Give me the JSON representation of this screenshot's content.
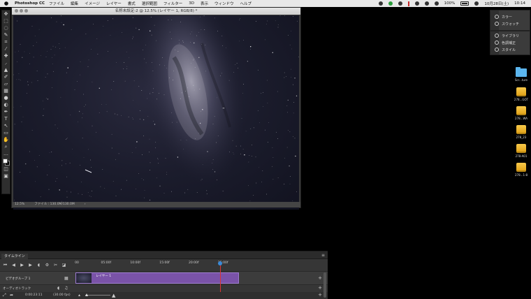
{
  "menubar": {
    "app_name": "Photoshop CC",
    "items": [
      "ファイル",
      "編集",
      "イメージ",
      "レイヤー",
      "書式",
      "選択範囲",
      "フィルター",
      "3D",
      "表示",
      "ウィンドウ",
      "ヘルプ"
    ],
    "battery": "100%",
    "date": "10月28日(土)",
    "time": "10:14"
  },
  "document": {
    "title": "名称未設定-2 @ 12.5% (レイヤー 1, RGB/8) *",
    "zoom": "12.5%",
    "file_info": "ファイル : 130.0M/130.0M"
  },
  "panels": {
    "top": [
      "カラー",
      "スウォッチ"
    ],
    "bottom": [
      "ライブラリ",
      "色調補正",
      "スタイル"
    ]
  },
  "desktop_icons": [
    {
      "label": "Scr...ture",
      "type": "folder"
    },
    {
      "label": "278...GOT",
      "type": "drive"
    },
    {
      "label": "278...WA",
      "type": "drive"
    },
    {
      "label": "278_23",
      "type": "drive"
    },
    {
      "label": "278-A01",
      "type": "drive"
    },
    {
      "label": "278...1-8",
      "type": "drive"
    }
  ],
  "timeline": {
    "tab_label": "タイムライン",
    "ruler_ticks": [
      "00",
      "05:00f",
      "10:00f",
      "15:00f",
      "20:00f",
      "25:00f"
    ],
    "playhead_fraction": 0.885,
    "video_group": "ビデオグループ 1",
    "clip_label": "レイヤー 1",
    "audio_track": "オーディオトラック",
    "timecode": "0:00:23:11",
    "fps": "(30.00 fps)"
  }
}
